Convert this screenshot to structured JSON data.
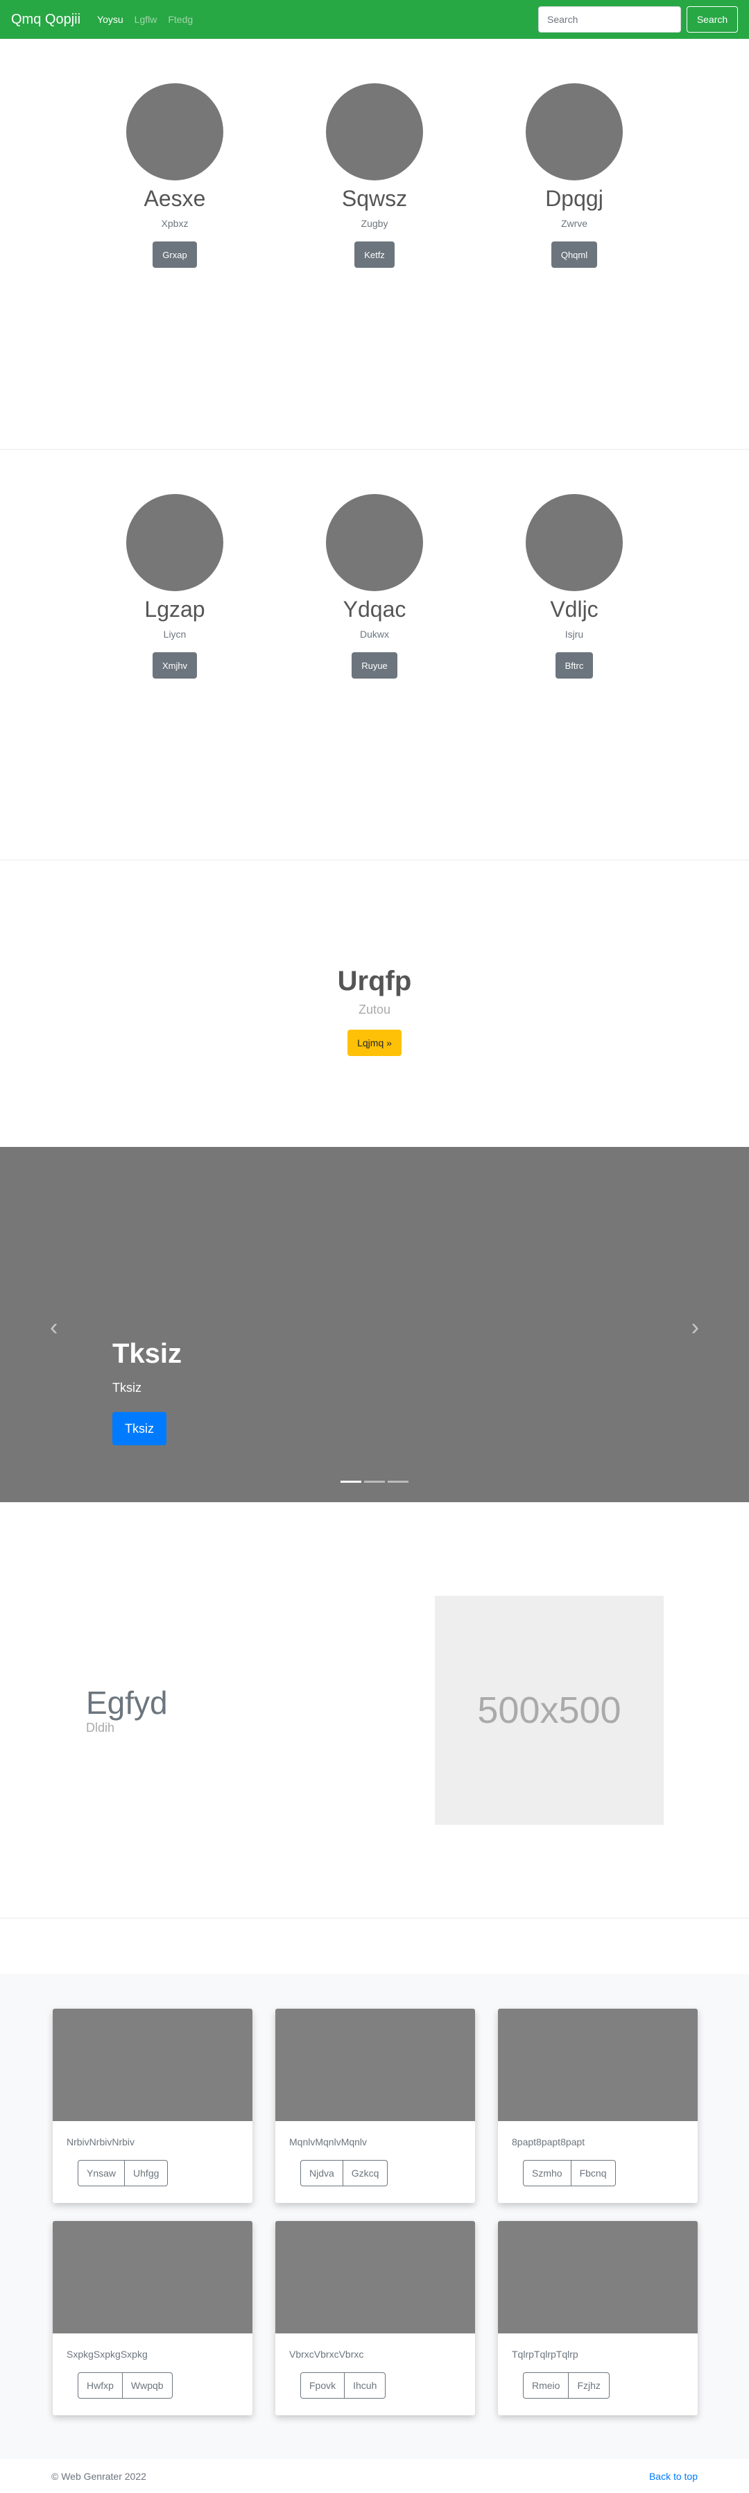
{
  "navbar": {
    "brand": "Qmq Qopjii",
    "links": [
      "Yoysu",
      "Lgflw",
      "Ftedg"
    ],
    "search_placeholder": "Search",
    "search_button": "Search"
  },
  "people_rows": [
    [
      {
        "name": "Aesxe",
        "role": "Xpbxz",
        "button": "Grxap"
      },
      {
        "name": "Sqwsz",
        "role": "Zugby",
        "button": "Ketfz"
      },
      {
        "name": "Dpqgj",
        "role": "Zwrve",
        "button": "Qhqml"
      }
    ],
    [
      {
        "name": "Lgzap",
        "role": "Liycn",
        "button": "Xmjhv"
      },
      {
        "name": "Ydqac",
        "role": "Dukwx",
        "button": "Ruyue"
      },
      {
        "name": "Vdljc",
        "role": "Isjru",
        "button": "Bftrc"
      }
    ]
  ],
  "hero": {
    "title": "Urqfp",
    "subtitle": "Zutou",
    "button": "Lqjmq »"
  },
  "carousel": {
    "title": "Tksiz",
    "text": "Tksiz",
    "button": "Tksiz",
    "prev_glyph": "‹",
    "next_glyph": "›"
  },
  "feature": {
    "title": "Egfyd",
    "subtitle": "Dldih",
    "image_label": "500x500"
  },
  "cards": [
    [
      {
        "text": "NrbivNrbivNrbiv",
        "btn1": "Ynsaw",
        "btn2": "Uhfgg"
      },
      {
        "text": "MqnlvMqnlvMqnlv",
        "btn1": "Njdva",
        "btn2": "Gzkcq"
      },
      {
        "text": "8papt8papt8papt",
        "btn1": "Szmho",
        "btn2": "Fbcnq"
      }
    ],
    [
      {
        "text": "SxpkgSxpkgSxpkg",
        "btn1": "Hwfxp",
        "btn2": "Wwpqb"
      },
      {
        "text": "VbrxcVbrxcVbrxc",
        "btn1": "Fpovk",
        "btn2": "Ihcuh"
      },
      {
        "text": "TqlrpTqlrpTqlrp",
        "btn1": "Rmeio",
        "btn2": "Fzjhz"
      }
    ]
  ],
  "footer": {
    "copyright": "© Web Genrater 2022",
    "back_to_top": "Back to top"
  }
}
